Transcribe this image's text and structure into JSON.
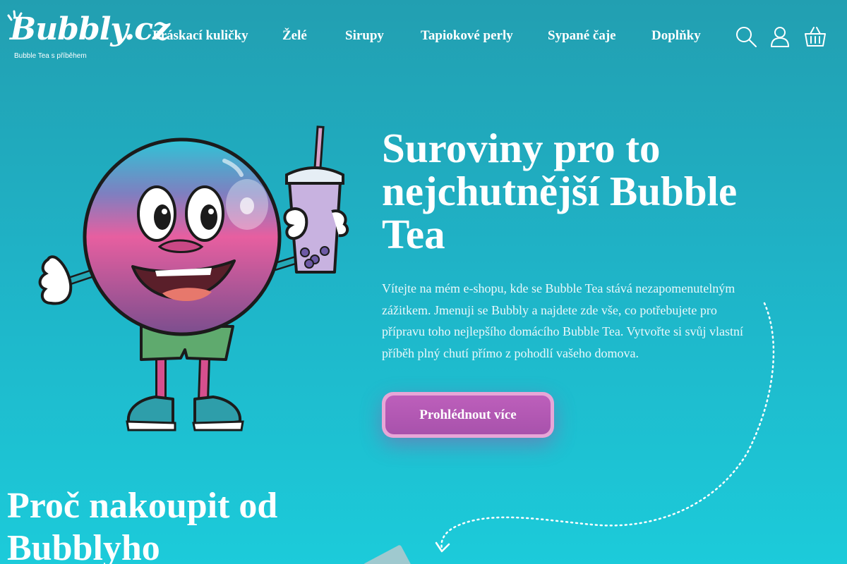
{
  "header": {
    "logo": {
      "word": "Bubbly.cz",
      "tagline": "Bubble Tea s příběhem"
    },
    "nav": [
      {
        "label": "Práskací kuličky"
      },
      {
        "label": "Želé"
      },
      {
        "label": "Sirupy"
      },
      {
        "label": "Tapiokové perly"
      },
      {
        "label": "Sypané čaje"
      },
      {
        "label": "Doplňky"
      }
    ],
    "icons": [
      "search-icon",
      "user-icon",
      "basket-icon"
    ]
  },
  "hero": {
    "title": "Suroviny pro to nejchutnější Bubble Tea",
    "text": "Vítejte na mém e-shopu, kde se Bubble Tea stává nezapomenutelným zážitkem. Jmenuji se Bubbly a najdete zde vše, co potřebujete pro přípravu toho nejlepšího domácího Bubble Tea. Vytvořte si svůj vlastní příběh plný chutí přímo z pohodlí vašeho domova.",
    "cta_label": "Prohlédnout více"
  },
  "section": {
    "title": "Proč nakoupit od Bubblyho"
  },
  "colors": {
    "bg_top": "#229fb1",
    "bg_bottom": "#1ccbda",
    "cta": "#b058b3",
    "cta_border": "#e7a6d7"
  }
}
